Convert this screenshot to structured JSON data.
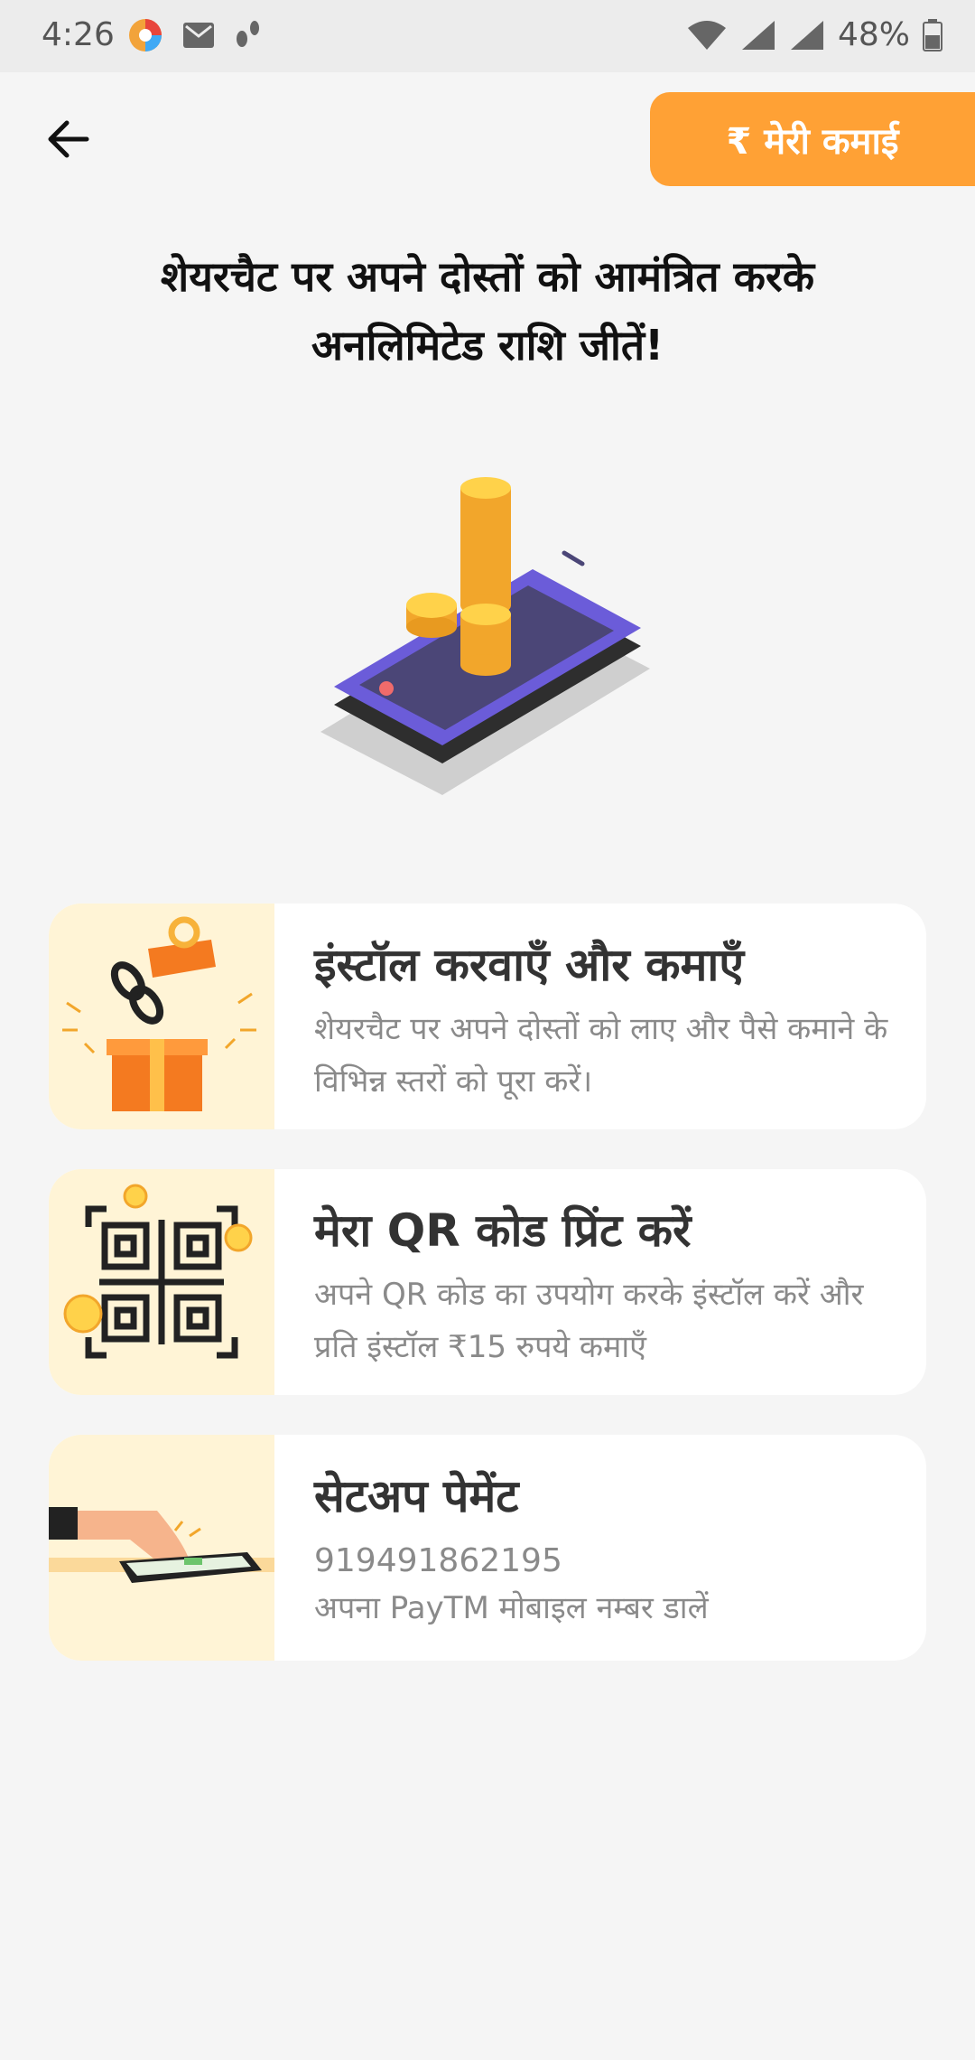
{
  "status_bar": {
    "time": "4:26",
    "battery_percent": "48%"
  },
  "header": {
    "back_icon": "arrow-left-icon",
    "earnings_button_label": "₹ मेरी कमाई",
    "accent_color": "#ffa135"
  },
  "headline": "शेयरचैट पर अपने दोस्तों को आमंत्रित करके अनलिमिटेड राशि जीतें!",
  "cards": [
    {
      "icon": "gift-link-icon",
      "title": "इंस्टॉल करवाएँ और कमाएँ",
      "description": "शेयरचैट पर अपने दोस्तों को लाए और पैसे कमाने के विभिन्न स्तरों को पूरा करें।"
    },
    {
      "icon": "qr-code-icon",
      "title": "मेरा QR कोड प्रिंट करें",
      "description": "अपने QR कोड का उपयोग करके इंस्टॉल करें और प्रति इंस्टॉल ₹15 रुपये कमाएँ"
    },
    {
      "icon": "payment-phone-icon",
      "title": "सेटअप पेमेंट",
      "number": "919491862195",
      "description": "अपना PayTM मोबाइल नम्बर डालें"
    }
  ]
}
